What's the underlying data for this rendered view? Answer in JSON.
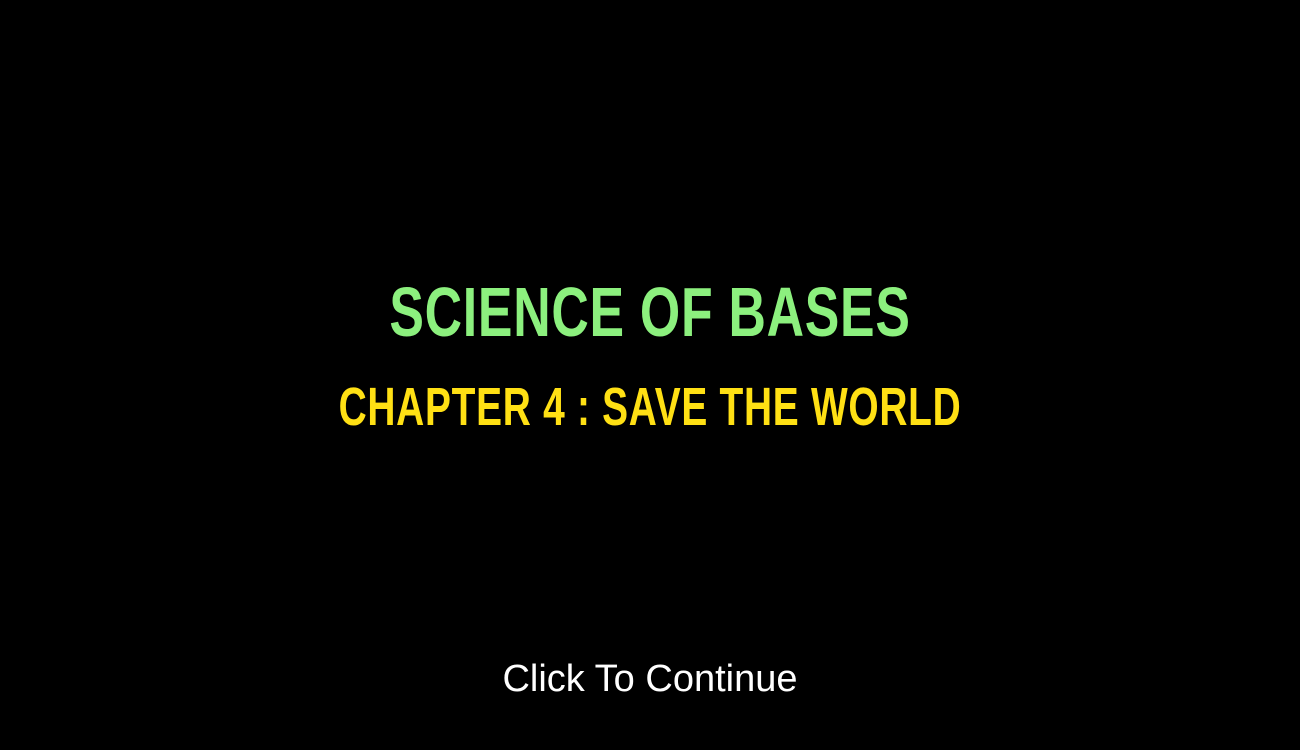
{
  "game": {
    "title": "Science of Bases",
    "chapter": "Chapter 4 : Save the World",
    "prompt": "Click To Continue"
  },
  "colors": {
    "background": "#000000",
    "title": "#8CF07E",
    "chapter": "#FFE014",
    "prompt": "#FFFFFF"
  }
}
